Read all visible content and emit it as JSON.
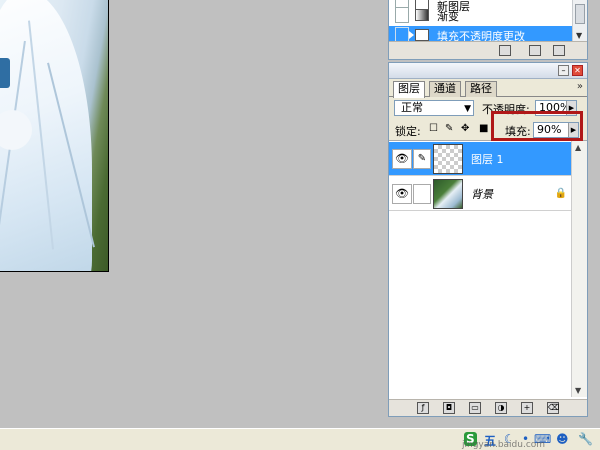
{
  "history": {
    "items": [
      {
        "label": "新图层",
        "icon": "new-layer-icon",
        "selected": false
      },
      {
        "label": "渐变",
        "icon": "gradient-icon",
        "selected": false
      },
      {
        "label": "填充不透明度更改",
        "icon": "history-state-icon",
        "selected": true
      }
    ]
  },
  "layers_panel": {
    "tabs": [
      "图层",
      "通道",
      "路径"
    ],
    "blend_mode": "正常",
    "opacity_label": "不透明度:",
    "opacity_value": "100%",
    "lock_label": "锁定:",
    "fill_label": "填充:",
    "fill_value": "90%",
    "layers": [
      {
        "name": "图层 1",
        "selected": true,
        "visible": true
      },
      {
        "name": "背景",
        "selected": false,
        "visible": true,
        "locked": true
      }
    ]
  },
  "tray": {
    "icons": [
      "ime-s-icon",
      "wubi-icon",
      "moon-icon",
      "dot-icon",
      "keyboard-icon",
      "user-icon",
      "settings-icon"
    ],
    "wubi_label": "五"
  },
  "watermark": "jingyan.baidu.com",
  "colors": {
    "selection": "#3399ff",
    "highlight_border": "#b01818",
    "workspace": "#c0c0c0"
  }
}
